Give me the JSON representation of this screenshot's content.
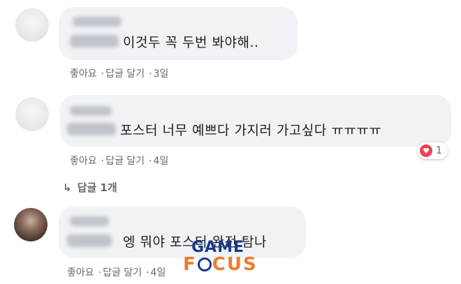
{
  "comments": [
    {
      "text": "이것두 꼭 두번 봐야해..",
      "actions": {
        "like": "좋아요",
        "reply": "답글 달기",
        "time": "3일"
      }
    },
    {
      "text": "포스터 너무 예쁘다 가지러 가고싶다 ㅠㅠㅠㅠ",
      "actions": {
        "like": "좋아요",
        "reply": "답글 달기",
        "time": "4일"
      },
      "reaction_count": "1",
      "replies_label": "답글 1개"
    },
    {
      "text": "엥 뭐야 포스터 완전 탐나",
      "actions": {
        "like": "좋아요",
        "reply": "답글 달기",
        "time": "4일"
      }
    }
  ],
  "separator": "·",
  "icons": {
    "reaction": "heart-icon",
    "reply": "reply-arrow-icon"
  },
  "colors": {
    "bubble": "#f0f2f5",
    "text": "#1c1e21",
    "meta": "#65676b",
    "heart": "#f33e58"
  },
  "watermark": {
    "line1": "GAME",
    "line2a": "F",
    "line2b": "CUS"
  }
}
